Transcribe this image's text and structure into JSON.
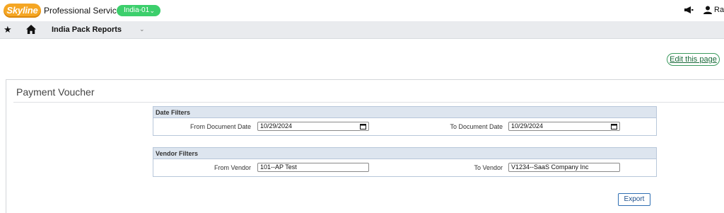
{
  "header": {
    "logo_text": "Skyline",
    "app_name": "Professional Services",
    "environment": "India-01",
    "user_name": "Ra"
  },
  "nav": {
    "module_title": "India Pack Reports"
  },
  "toolbar": {
    "edit_label": "Edit this page"
  },
  "page": {
    "title": "Payment Voucher"
  },
  "date_filters": {
    "heading": "Date Filters",
    "from_label": "From Document Date",
    "from_value": "10/29/2024",
    "to_label": "To Document Date",
    "to_value": "10/29/2024"
  },
  "vendor_filters": {
    "heading": "Vendor Filters",
    "from_label": "From Vendor",
    "from_value": "101--AP Test",
    "to_label": "To Vendor",
    "to_value": "V1234--SaaS Company Inc"
  },
  "actions": {
    "export_label": "Export"
  },
  "colors": {
    "logo": "#f5a623",
    "env_badge": "#3ccf6c",
    "filter_header": "#dde5ef",
    "edit_button_border": "#3c9a5f",
    "export_button_border": "#2f6fb3"
  }
}
